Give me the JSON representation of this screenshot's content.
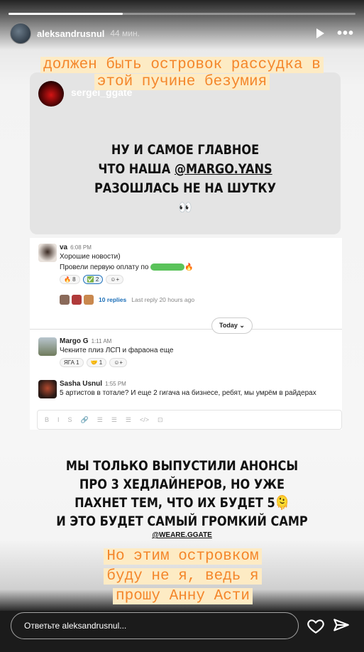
{
  "story": {
    "username": "aleksandrusnul",
    "time": "44 мин.",
    "progress": 0.33,
    "top_caption": [
      "должен быть островок рассудка в",
      "этой пучине безумия"
    ],
    "card": {
      "user": "sergei_ggate",
      "text_line1": "НУ И САМОЕ ГЛАВНОЕ",
      "text_line2_pre": "ЧТО НАША ",
      "mention": "@MARGO.YANS",
      "text_line3": "РАЗОШЛАСЬ НЕ НА ШУТКУ",
      "emoji": "👀"
    },
    "slack": {
      "msg1": {
        "name": "va",
        "time": "6:08 PM",
        "line1": "Хорошие новости)",
        "line2": "Провели первую оплату по",
        "fire": "🔥",
        "reactions": [
          "🔥 8",
          "✅ 2",
          "☺+"
        ]
      },
      "replies_link": "10 replies",
      "replies_meta": "Last reply 20 hours ago",
      "today": "Today ⌄",
      "msg2": {
        "name": "Margo G",
        "time": "1:11 AM",
        "text": "Чекните плиз ЛСП и фараона еще",
        "reactions": [
          "ЯГА 1",
          "🤝 1",
          "☺+"
        ]
      },
      "msg3": {
        "name": "Sasha Usnul",
        "time": "1:55 PM",
        "text": "5 артистов в тотале? И еще 2 гигача на бизнесе, ребят, мы умрём в райдерах"
      },
      "composer_tools": [
        "B",
        "I",
        "S",
        "🔗",
        "☰",
        "☰",
        "☰",
        "</>",
        "⊡"
      ]
    },
    "main_text": [
      "МЫ ТОЛЬКО ВЫПУСТИЛИ АНОНСЫ",
      "ПРО 3 ХЕДЛАЙНЕРОВ, НО УЖЕ",
      "ПАХНЕТ ТЕМ, ЧТО ИХ БУДЕТ 5🫠",
      "И ЭТО БУДЕТ САМЫЙ ГРОМКИЙ САМР"
    ],
    "handle": "@WEARE.GGATE",
    "bottom_caption": [
      "Но этим островком",
      "буду не я, ведь я",
      "прошу Анну Асти"
    ],
    "reply_placeholder": "Ответьте aleksandrusnul...",
    "icons": {
      "play": "play-icon",
      "more": "more-icon",
      "like": "heart-icon",
      "share": "send-icon"
    },
    "colors": {
      "caption_text": "#f4862a",
      "caption_bg": "#fdebc4",
      "slack_link": "#1d6fb8",
      "pill_green": "#5ac35a"
    }
  }
}
